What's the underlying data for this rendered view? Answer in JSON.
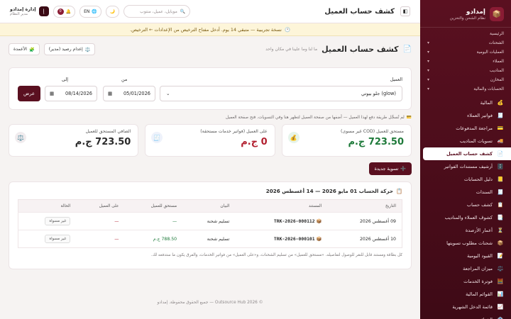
{
  "brand": {
    "name": "إمدادو",
    "subtitle": "نظام الشحن والتخزين"
  },
  "sidebar": {
    "sections": [
      {
        "label": "الرئيسية",
        "chevron": false
      },
      {
        "label": "الشحنات",
        "chevron": true
      },
      {
        "label": "العمليات اليومية",
        "chevron": true
      },
      {
        "label": "العملاء",
        "chevron": true
      },
      {
        "label": "المناديب",
        "chevron": true
      },
      {
        "label": "المخازن",
        "chevron": true
      },
      {
        "label": "الحسابات والمالية",
        "chevron": true
      }
    ],
    "items": [
      {
        "label": "المالية",
        "icon": "💰"
      },
      {
        "label": "فواتير العملاء",
        "icon": "🧾"
      },
      {
        "label": "مراجعة المدفوعات",
        "icon": "💳"
      },
      {
        "label": "تسويات المناديب",
        "icon": "🚚"
      },
      {
        "label": "كشف حساب العميل",
        "icon": "📄",
        "active": true
      },
      {
        "label": "أرشيف مستندات الفواتير",
        "icon": "🗄️"
      },
      {
        "label": "دليل الحسابات",
        "icon": "📒"
      },
      {
        "label": "السندات",
        "icon": "🧾"
      },
      {
        "label": "كشف حساب",
        "icon": "📋"
      },
      {
        "label": "كشوف العملاء والمناديب",
        "icon": "📑"
      },
      {
        "label": "أعمار الأرصدة",
        "icon": "⏳"
      },
      {
        "label": "شحنات مطلوب تسويتها",
        "icon": "📦"
      },
      {
        "label": "القيود اليومية",
        "icon": "📝"
      },
      {
        "label": "ميزان المراجعة",
        "icon": "⚖️"
      },
      {
        "label": "فوترة الخدمات",
        "icon": "🧮"
      },
      {
        "label": "القوائم المالية",
        "icon": "📊"
      },
      {
        "label": "قائمة الدخل الشهرية",
        "icon": "📈"
      },
      {
        "label": "الخزائن",
        "icon": "🏦"
      }
    ]
  },
  "topbar": {
    "title": "كشف حساب العميل",
    "search_placeholder": "موبايل، عميل، منتوب",
    "lang": "EN",
    "notif_count": "0",
    "user_name": "إدارة إمدادو",
    "user_role": "مدير النظام",
    "user_initial": "إ"
  },
  "trial": {
    "icon": "🕐",
    "text": "نسخة تجريبية — متبقي 14 يوم. أدخل مفتاح الترخيص من الإعدادات ← الترخيص."
  },
  "page": {
    "title": "كشف حساب العميل",
    "subtitle": "ما لنا وما علينا في مكان واحد",
    "btn_columns": "الأعمدة",
    "btn_opening": "إعدام رصيد (مدير)"
  },
  "filter": {
    "client_label": "العميل",
    "client_value": "(glow) جلو بيوتي",
    "from_label": "من",
    "from_value": "05/01/2026",
    "to_label": "إلى",
    "to_value": "08/14/2026",
    "show_btn": "عرض"
  },
  "note": "لم تُسجَّل طريقة دفع لهذا العميل — أضفها من صفحة العميل لتظهر هنا وفي التسويات. فتح صفحة العميل",
  "stats": [
    {
      "label": "مستحق للعميل (COD غير مسوى)",
      "value": "723.50 ج.م",
      "icon": "💰",
      "tone": "green",
      "icon_bg": "#e6f4ea"
    },
    {
      "label": "على العميل (فواتير خدمات مستحقة)",
      "value": "0 ج.م",
      "icon": "🧾",
      "tone": "red",
      "icon_bg": "#eef2fb"
    },
    {
      "label": "الصافي المستحق للعميل",
      "value": "723.50 ج.م",
      "icon": "⚖️",
      "tone": "dark",
      "icon_bg": "#f1ecee"
    }
  ],
  "new_settlement_btn": "تسوية جديدة",
  "ledger": {
    "title": "حركة الحساب 01 مايو 2026 — 14 أغسطس 2026",
    "columns": [
      "التاريخ",
      "المستند",
      "البيان",
      "مستحق للعميل",
      "على العميل",
      "الحالة"
    ],
    "rows": [
      {
        "date": "09 أغسطس 2026",
        "doc": "TRK-2026-000112",
        "desc": "تسليم شحنة",
        "credit": "—",
        "debit": "—",
        "status": "غير مسواة",
        "credit_tone": "green"
      },
      {
        "date": "10 أغسطس 2026",
        "doc": "TRK-2026-000101",
        "desc": "تسليم شحنة",
        "credit": "788.50 ج.م",
        "debit": "—",
        "status": "غير مسواة",
        "credit_tone": "green"
      }
    ],
    "note": "كل بطاقة ومستند قابل للنقر للوصول لتفاصيله. «مستحق للعميل» من تسليم الشحنات، و«على العميل» من فواتير الخدمات، والفرق يكون ما ستدفعه لك."
  },
  "footer": "© 2026 Outsource Hub — جميع الحقوق محفوظة. إمدادو"
}
